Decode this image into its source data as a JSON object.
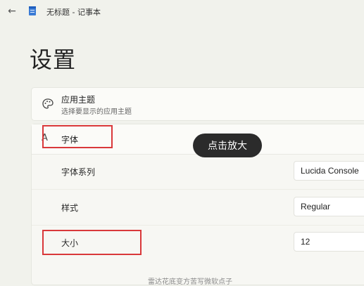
{
  "titlebar": {
    "title": "无标题 - 记事本",
    "back_icon": "←"
  },
  "page": {
    "title": "设置"
  },
  "theme": {
    "title": "应用主题",
    "subtitle": "选择要显示的应用主题"
  },
  "font": {
    "title": "字体",
    "icon_glyph": "A",
    "rows": {
      "family": {
        "label": "字体系列",
        "value": "Lucida Console"
      },
      "style": {
        "label": "样式",
        "value": "Regular"
      },
      "size": {
        "label": "大小",
        "value": "12"
      }
    }
  },
  "footer": {
    "partial_text": "雷达花底变方苦写微软点子"
  },
  "tooltip": {
    "label": "点击放大"
  },
  "colors": {
    "highlight": "#d9383a",
    "tooltip_bg": "#2b2b2b"
  }
}
